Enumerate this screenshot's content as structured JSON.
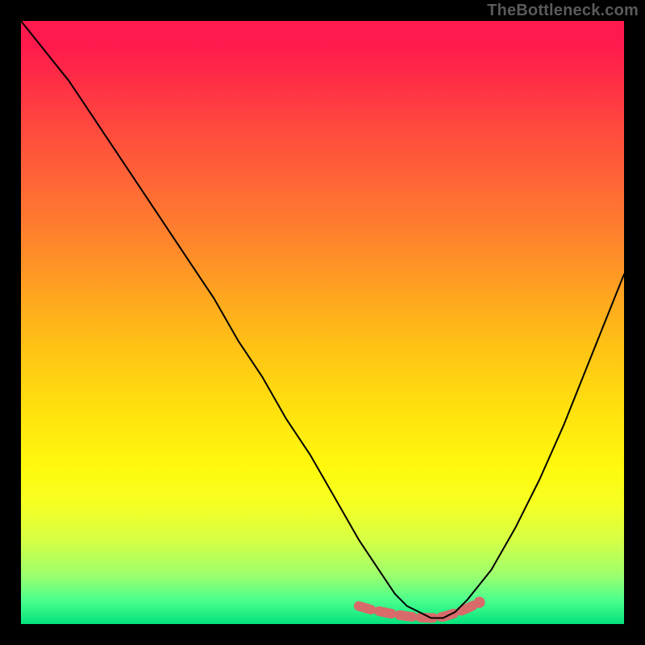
{
  "watermark": {
    "text": "TheBottleneck.com"
  },
  "chart_data": {
    "type": "line",
    "title": "",
    "xlabel": "",
    "ylabel": "",
    "xlim": [
      0,
      100
    ],
    "ylim": [
      0,
      100
    ],
    "grid": false,
    "legend": false,
    "background": "rainbow-gradient-red-to-green-vertical",
    "series": [
      {
        "name": "bottleneck-curve",
        "style": "line",
        "color": "#000000",
        "x": [
          0,
          4,
          8,
          12,
          16,
          20,
          24,
          28,
          32,
          36,
          40,
          44,
          48,
          52,
          56,
          58,
          60,
          62,
          64,
          66,
          68,
          70,
          72,
          74,
          78,
          82,
          86,
          90,
          94,
          98,
          100
        ],
        "values": [
          100,
          95,
          90,
          84,
          78,
          72,
          66,
          60,
          54,
          47,
          41,
          34,
          28,
          21,
          14,
          11,
          8,
          5,
          3,
          2,
          1,
          1,
          2,
          4,
          9,
          16,
          24,
          33,
          43,
          53,
          58
        ]
      },
      {
        "name": "bottom-band",
        "style": "thick-dot-run",
        "color": "#d86a6a",
        "x": [
          56,
          58,
          60,
          62,
          64,
          66,
          68,
          70,
          72,
          74,
          76
        ],
        "values": [
          3,
          2.4,
          2.0,
          1.6,
          1.3,
          1.1,
          1.0,
          1.2,
          1.8,
          2.6,
          3.6
        ]
      }
    ],
    "annotations": []
  }
}
